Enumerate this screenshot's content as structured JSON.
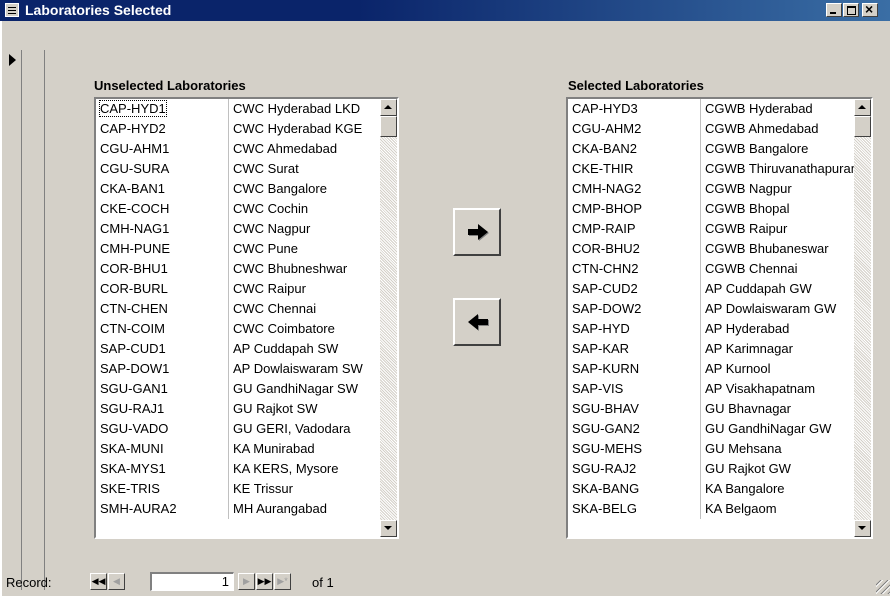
{
  "window": {
    "title": "Laboratories Selected"
  },
  "unselected": {
    "label": "Unselected  Laboratories",
    "items": [
      {
        "code": "CAP-HYD1",
        "name": "CWC Hyderabad LKD"
      },
      {
        "code": "CAP-HYD2",
        "name": "CWC Hyderabad KGE"
      },
      {
        "code": "CGU-AHM1",
        "name": "CWC Ahmedabad"
      },
      {
        "code": "CGU-SURA",
        "name": "CWC Surat"
      },
      {
        "code": "CKA-BAN1",
        "name": "CWC Bangalore"
      },
      {
        "code": "CKE-COCH",
        "name": "CWC Cochin"
      },
      {
        "code": "CMH-NAG1",
        "name": "CWC Nagpur"
      },
      {
        "code": "CMH-PUNE",
        "name": "CWC Pune"
      },
      {
        "code": "COR-BHU1",
        "name": "CWC Bhubneshwar"
      },
      {
        "code": "COR-BURL",
        "name": "CWC Raipur"
      },
      {
        "code": "CTN-CHEN",
        "name": "CWC Chennai"
      },
      {
        "code": "CTN-COIM",
        "name": "CWC Coimbatore"
      },
      {
        "code": "SAP-CUD1",
        "name": "AP Cuddapah SW"
      },
      {
        "code": "SAP-DOW1",
        "name": "AP Dowlaiswaram SW"
      },
      {
        "code": "SGU-GAN1",
        "name": "GU GandhiNagar SW"
      },
      {
        "code": "SGU-RAJ1",
        "name": "GU Rajkot SW"
      },
      {
        "code": "SGU-VADO",
        "name": "GU GERI, Vadodara"
      },
      {
        "code": "SKA-MUNI",
        "name": "KA Munirabad"
      },
      {
        "code": "SKA-MYS1",
        "name": "KA KERS, Mysore"
      },
      {
        "code": "SKE-TRIS",
        "name": "KE Trissur"
      },
      {
        "code": "SMH-AURA2",
        "name": "MH Aurangabad"
      }
    ]
  },
  "selected": {
    "label": "Selected Laboratories",
    "items": [
      {
        "code": "CAP-HYD3",
        "name": "CGWB  Hyderabad"
      },
      {
        "code": "CGU-AHM2",
        "name": "CGWB Ahmedabad"
      },
      {
        "code": "CKA-BAN2",
        "name": "CGWB Bangalore"
      },
      {
        "code": "CKE-THIR",
        "name": "CGWB Thiruvanathapuram"
      },
      {
        "code": "CMH-NAG2",
        "name": "CGWB Nagpur"
      },
      {
        "code": "CMP-BHOP",
        "name": "CGWB Bhopal"
      },
      {
        "code": "CMP-RAIP",
        "name": "CGWB Raipur"
      },
      {
        "code": "COR-BHU2",
        "name": "CGWB Bhubaneswar"
      },
      {
        "code": "CTN-CHN2",
        "name": "CGWB Chennai"
      },
      {
        "code": "SAP-CUD2",
        "name": "AP Cuddapah GW"
      },
      {
        "code": "SAP-DOW2",
        "name": "AP Dowlaiswaram GW"
      },
      {
        "code": "SAP-HYD",
        "name": "AP Hyderabad"
      },
      {
        "code": "SAP-KAR",
        "name": "AP Karimnagar"
      },
      {
        "code": "SAP-KURN",
        "name": "AP Kurnool"
      },
      {
        "code": "SAP-VIS",
        "name": "AP Visakhapatnam"
      },
      {
        "code": "SGU-BHAV",
        "name": "GU Bhavnagar"
      },
      {
        "code": "SGU-GAN2",
        "name": "GU GandhiNagar GW"
      },
      {
        "code": "SGU-MEHS",
        "name": "GU Mehsana"
      },
      {
        "code": "SGU-RAJ2",
        "name": "GU Rajkot GW"
      },
      {
        "code": "SKA-BANG",
        "name": "KA Bangalore"
      },
      {
        "code": "SKA-BELG",
        "name": "KA Belgaom"
      }
    ]
  },
  "buttons": {
    "move_right_icon": "arrow-right-icon",
    "move_left_icon": "arrow-left-icon"
  },
  "record_nav": {
    "label": "Record:",
    "current": "1",
    "of_text": "of  1"
  }
}
